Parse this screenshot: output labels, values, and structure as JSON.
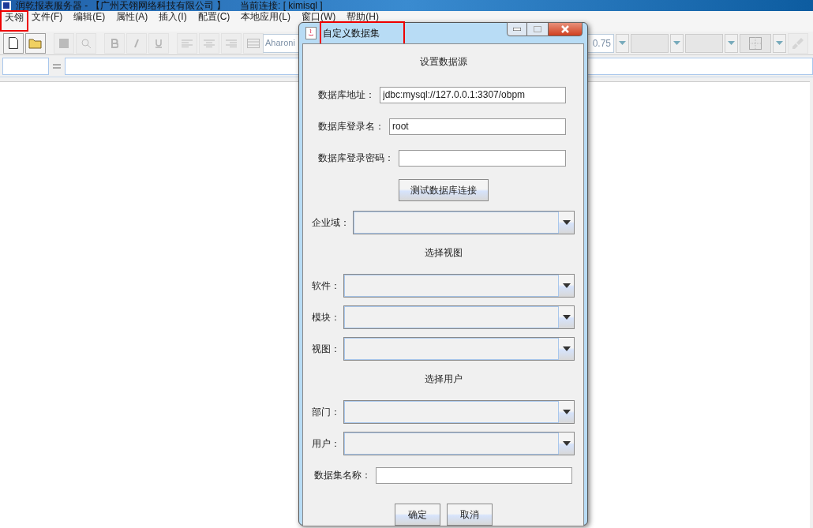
{
  "app": {
    "title": "润乾报表服务器 - 【广州天翎网络科技有限公司 】",
    "connection": "当前连接: [ kimisql ]"
  },
  "menu": [
    {
      "label": "天翎",
      "annotated": true
    },
    {
      "label": "文件(F)",
      "annotated": false
    },
    {
      "label": "编辑(E)",
      "annotated": false
    },
    {
      "label": "属性(A)",
      "annotated": false
    },
    {
      "label": "插入(I)",
      "annotated": false
    },
    {
      "label": "配置(C)",
      "annotated": false
    },
    {
      "label": "本地应用(L)",
      "annotated": false
    },
    {
      "label": "窗口(W)",
      "annotated": false
    },
    {
      "label": "帮助(H)",
      "annotated": false
    }
  ],
  "toolbar": {
    "font": "Aharoni",
    "zoom": "0.75"
  },
  "dialog": {
    "title": "自定义数据集",
    "title_annotated": true,
    "rows": [
      {
        "kind": "heading",
        "text": "设置数据源"
      },
      {
        "kind": "text",
        "label": "数据库地址：",
        "value": "jdbc:mysql://127.0.0.1:3307/obpm"
      },
      {
        "kind": "text",
        "label": "数据库登录名：",
        "value": "root"
      },
      {
        "kind": "text",
        "label": "数据库登录密码：",
        "value": ""
      },
      {
        "kind": "button",
        "text": "测试数据库连接"
      },
      {
        "kind": "combo",
        "label": "企业域："
      },
      {
        "kind": "heading",
        "text": "选择视图"
      },
      {
        "kind": "combo",
        "label": "软件："
      },
      {
        "kind": "combo",
        "label": "模块："
      },
      {
        "kind": "combo",
        "label": "视图："
      },
      {
        "kind": "heading",
        "text": "选择用户"
      },
      {
        "kind": "combo",
        "label": "部门："
      },
      {
        "kind": "combo",
        "label": "用户："
      },
      {
        "kind": "text",
        "label": "数据集名称：",
        "value": ""
      }
    ],
    "buttons": [
      "确定",
      "取消"
    ]
  }
}
